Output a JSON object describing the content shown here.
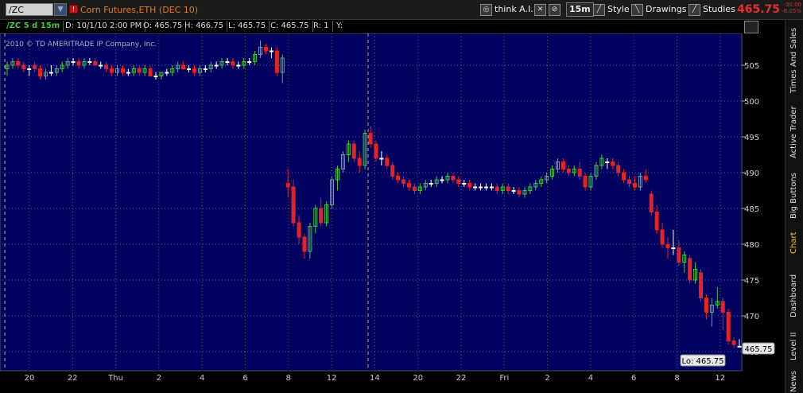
{
  "toolbar": {
    "symbol": "/ZC",
    "description": "Corn Futures,ETH (DEC 10)",
    "buttons": [
      "think A.I.",
      "15m",
      "Style",
      "Drawings",
      "Studies"
    ],
    "last_price": "465.75",
    "change": "-30.00",
    "change_pct": "-6.05%"
  },
  "infobar": {
    "series": "/ZC 5 d 15m",
    "date": "D: 10/1/10 2:00 PM",
    "open": "O: 465.75",
    "high": "H: 466.75",
    "low": "L: 465.75",
    "close": "C: 465.75",
    "range": "R: 1",
    "y": "Y:",
    "copyright": "2010 © TD AMERITRADE IP Company, Inc."
  },
  "right_tabs": [
    "Times And Sales",
    "Active Trader",
    "Big Buttons",
    "Chart",
    "Dashboard",
    "Level II",
    "News"
  ],
  "chart_data": {
    "type": "candlestick",
    "ylim": [
      465,
      509
    ],
    "y_ticks": [
      505,
      500,
      495,
      490,
      485,
      480,
      475,
      470,
      465
    ],
    "x_ticks": [
      "20",
      "22",
      "Thu",
      "2",
      "4",
      "6",
      "8",
      "12",
      "14",
      "20",
      "22",
      "Fri",
      "2",
      "4",
      "6",
      "8",
      "12"
    ],
    "last_label": "465.75",
    "low_label": "Lo: 465.75",
    "colors": {
      "up": "#3ec83e",
      "down": "#e82222",
      "neutral": "#ffffff",
      "bg": "#000060",
      "grid": "#7a6030"
    },
    "candles": [
      [
        504.5,
        505.5,
        503.5,
        505.0
      ],
      [
        505.0,
        506.0,
        504.5,
        505.5
      ],
      [
        505.5,
        506.0,
        504.5,
        505.0
      ],
      [
        505.0,
        505.5,
        504.0,
        504.5
      ],
      [
        504.5,
        505.0,
        503.5,
        504.5
      ],
      [
        505.0,
        505.5,
        504.0,
        504.5
      ],
      [
        504.5,
        505.0,
        503.0,
        503.5
      ],
      [
        503.5,
        504.5,
        503.0,
        504.0
      ],
      [
        504.0,
        505.0,
        503.5,
        504.0
      ],
      [
        504.0,
        505.0,
        503.5,
        504.5
      ],
      [
        504.5,
        505.5,
        504.0,
        505.0
      ],
      [
        505.0,
        506.0,
        504.5,
        505.5
      ],
      [
        505.5,
        506.0,
        505.0,
        505.5
      ],
      [
        505.5,
        506.0,
        504.5,
        505.0
      ],
      [
        505.0,
        506.0,
        504.5,
        505.5
      ],
      [
        505.5,
        506.0,
        505.0,
        505.5
      ],
      [
        505.5,
        506.0,
        505.0,
        505.0
      ],
      [
        505.0,
        505.5,
        504.5,
        505.0
      ],
      [
        505.0,
        505.5,
        504.0,
        504.5
      ],
      [
        504.5,
        505.0,
        503.5,
        504.0
      ],
      [
        504.0,
        505.0,
        503.5,
        504.5
      ],
      [
        504.5,
        505.0,
        503.5,
        504.0
      ],
      [
        504.0,
        504.5,
        503.5,
        504.0
      ],
      [
        504.0,
        505.0,
        503.5,
        504.5
      ],
      [
        504.5,
        505.0,
        503.5,
        504.0
      ],
      [
        504.0,
        505.0,
        503.5,
        504.5
      ],
      [
        504.5,
        505.0,
        503.5,
        503.5
      ],
      [
        503.5,
        504.0,
        503.0,
        503.5
      ],
      [
        503.5,
        504.0,
        503.0,
        504.0
      ],
      [
        504.0,
        504.5,
        503.5,
        504.0
      ],
      [
        504.0,
        505.0,
        503.5,
        504.5
      ],
      [
        504.5,
        505.5,
        504.0,
        505.0
      ],
      [
        505.0,
        505.5,
        504.5,
        504.5
      ],
      [
        504.5,
        505.0,
        504.0,
        504.5
      ],
      [
        504.5,
        505.0,
        503.5,
        504.0
      ],
      [
        504.0,
        505.0,
        503.5,
        504.5
      ],
      [
        504.5,
        505.0,
        504.0,
        504.5
      ],
      [
        504.5,
        505.5,
        504.0,
        505.0
      ],
      [
        505.0,
        505.5,
        504.5,
        505.0
      ],
      [
        505.0,
        506.0,
        504.5,
        505.5
      ],
      [
        505.5,
        506.0,
        505.0,
        505.5
      ],
      [
        505.5,
        506.0,
        504.5,
        505.0
      ],
      [
        505.0,
        505.5,
        504.5,
        505.0
      ],
      [
        505.0,
        506.0,
        504.5,
        505.5
      ],
      [
        505.5,
        506.0,
        505.0,
        505.5
      ],
      [
        505.5,
        507.0,
        505.0,
        506.5
      ],
      [
        506.5,
        508.5,
        506.0,
        507.5
      ],
      [
        507.5,
        508.0,
        506.5,
        507.0
      ],
      [
        507.0,
        507.5,
        506.0,
        507.0
      ],
      [
        507.0,
        507.5,
        503.5,
        504.0
      ],
      [
        504.0,
        506.5,
        502.5,
        506.0
      ],
      [
        488.5,
        490.5,
        486.5,
        488.0
      ],
      [
        488.0,
        489.0,
        482.5,
        483.0
      ],
      [
        483.0,
        484.0,
        480.0,
        481.0
      ],
      [
        481.0,
        481.5,
        478.0,
        479.0
      ],
      [
        479.0,
        483.0,
        478.0,
        482.5
      ],
      [
        482.5,
        485.5,
        481.5,
        485.0
      ],
      [
        485.0,
        486.5,
        482.5,
        483.0
      ],
      [
        483.0,
        486.0,
        482.5,
        485.5
      ],
      [
        485.5,
        489.5,
        485.0,
        489.0
      ],
      [
        489.0,
        491.0,
        487.5,
        490.5
      ],
      [
        490.5,
        493.0,
        490.0,
        492.5
      ],
      [
        492.5,
        494.5,
        491.5,
        494.0
      ],
      [
        494.0,
        494.5,
        491.5,
        492.0
      ],
      [
        492.0,
        493.0,
        490.0,
        491.0
      ],
      [
        491.0,
        496.0,
        490.5,
        495.5
      ],
      [
        495.5,
        496.5,
        493.5,
        494.0
      ],
      [
        494.0,
        494.5,
        491.5,
        492.0
      ],
      [
        492.0,
        493.0,
        491.0,
        492.0
      ],
      [
        492.0,
        492.5,
        490.5,
        491.0
      ],
      [
        491.0,
        491.5,
        489.0,
        489.5
      ],
      [
        489.5,
        490.0,
        488.5,
        489.0
      ],
      [
        489.0,
        489.5,
        488.0,
        488.5
      ],
      [
        488.5,
        489.0,
        487.5,
        488.0
      ],
      [
        488.0,
        488.5,
        487.0,
        487.5
      ],
      [
        487.5,
        488.5,
        487.0,
        488.0
      ],
      [
        488.0,
        489.0,
        487.5,
        488.5
      ],
      [
        488.5,
        489.0,
        488.0,
        488.5
      ],
      [
        488.5,
        489.5,
        488.0,
        489.0
      ],
      [
        489.0,
        489.5,
        488.5,
        489.0
      ],
      [
        489.0,
        490.0,
        488.5,
        489.5
      ],
      [
        489.5,
        490.0,
        488.5,
        489.0
      ],
      [
        489.0,
        489.5,
        488.0,
        488.5
      ],
      [
        488.5,
        489.0,
        488.0,
        488.5
      ],
      [
        488.5,
        489.0,
        487.5,
        488.0
      ],
      [
        488.0,
        488.5,
        487.5,
        488.0
      ],
      [
        488.0,
        488.5,
        487.5,
        488.0
      ],
      [
        488.0,
        488.5,
        487.5,
        488.0
      ],
      [
        488.0,
        488.5,
        487.5,
        488.0
      ],
      [
        488.0,
        488.5,
        487.0,
        487.5
      ],
      [
        487.5,
        488.5,
        487.0,
        488.0
      ],
      [
        488.0,
        488.5,
        487.0,
        487.5
      ],
      [
        487.5,
        488.0,
        487.0,
        487.5
      ],
      [
        487.5,
        488.0,
        486.5,
        487.0
      ],
      [
        487.0,
        488.0,
        486.5,
        487.5
      ],
      [
        487.5,
        488.5,
        487.0,
        488.0
      ],
      [
        488.0,
        489.0,
        487.5,
        488.5
      ],
      [
        488.5,
        489.5,
        488.0,
        489.0
      ],
      [
        489.0,
        490.0,
        488.5,
        489.5
      ],
      [
        489.5,
        491.0,
        489.0,
        490.5
      ],
      [
        490.5,
        492.0,
        490.0,
        491.5
      ],
      [
        491.5,
        492.0,
        490.0,
        490.5
      ],
      [
        490.5,
        491.0,
        489.5,
        490.0
      ],
      [
        490.0,
        491.0,
        489.5,
        490.5
      ],
      [
        490.5,
        491.5,
        489.0,
        489.5
      ],
      [
        489.5,
        490.0,
        487.5,
        488.0
      ],
      [
        488.0,
        490.0,
        487.5,
        489.5
      ],
      [
        489.5,
        491.5,
        489.0,
        491.0
      ],
      [
        491.0,
        492.5,
        490.5,
        492.0
      ],
      [
        491.5,
        492.0,
        490.5,
        491.5
      ],
      [
        491.5,
        492.0,
        490.5,
        491.0
      ],
      [
        491.0,
        491.5,
        489.5,
        490.0
      ],
      [
        490.0,
        490.5,
        488.5,
        489.0
      ],
      [
        489.0,
        489.5,
        488.0,
        488.5
      ],
      [
        488.5,
        489.5,
        487.5,
        488.0
      ],
      [
        488.0,
        490.0,
        487.5,
        489.5
      ],
      [
        489.5,
        490.5,
        488.5,
        489.0
      ],
      [
        487.0,
        487.5,
        484.0,
        484.5
      ],
      [
        484.5,
        485.5,
        481.5,
        482.0
      ],
      [
        482.0,
        483.0,
        479.5,
        480.0
      ],
      [
        480.0,
        481.0,
        478.0,
        479.5
      ],
      [
        479.5,
        482.0,
        478.5,
        479.5
      ],
      [
        479.5,
        480.5,
        477.0,
        477.5
      ],
      [
        477.5,
        479.0,
        476.0,
        478.5
      ],
      [
        478.0,
        478.5,
        474.5,
        475.0
      ],
      [
        475.0,
        477.5,
        474.5,
        476.5
      ],
      [
        476.0,
        476.5,
        472.0,
        472.5
      ],
      [
        472.5,
        473.0,
        469.5,
        470.5
      ],
      [
        470.5,
        472.5,
        468.5,
        471.5
      ],
      [
        471.5,
        474.0,
        471.0,
        472.0
      ],
      [
        472.0,
        472.5,
        468.0,
        470.5
      ],
      [
        470.5,
        471.0,
        466.0,
        466.5
      ],
      [
        466.5,
        467.0,
        465.5,
        466.0
      ],
      [
        465.75,
        466.75,
        465.75,
        465.75
      ]
    ]
  }
}
